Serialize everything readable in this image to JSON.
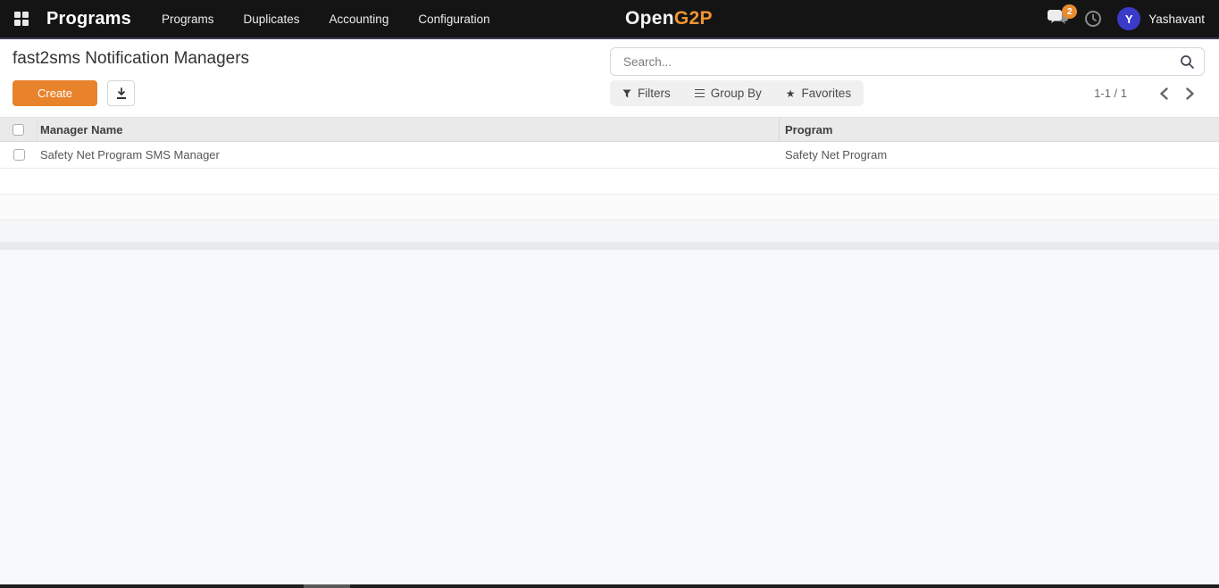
{
  "nav": {
    "brand": "Programs",
    "items": [
      {
        "label": "Programs"
      },
      {
        "label": "Duplicates"
      },
      {
        "label": "Accounting"
      },
      {
        "label": "Configuration"
      }
    ],
    "logo": {
      "part1": "Open",
      "part2": "G2P"
    },
    "messages_badge": "2",
    "user": {
      "initial": "Y",
      "name": "Yashavant"
    }
  },
  "header": {
    "title": "fast2sms Notification Managers",
    "create_label": "Create",
    "search_placeholder": "Search..."
  },
  "controls": {
    "filters_label": "Filters",
    "group_by_label": "Group By",
    "favorites_label": "Favorites",
    "pager": "1-1 / 1"
  },
  "table": {
    "columns": [
      "Manager Name",
      "Program"
    ],
    "rows": [
      {
        "manager_name": "Safety Net Program SMS Manager",
        "program": "Safety Net Program"
      }
    ]
  },
  "icons": {
    "apps_icon": "2x2-grid",
    "messages_icon": "speech-bubbles",
    "activities_icon": "clock",
    "search_icon": "magnifier",
    "download_icon": "arrow-into-tray",
    "filter_icon": "funnel",
    "group_by_icon": "three-bars",
    "favorites_star_icon": "★",
    "chevron_left_icon": "‹",
    "chevron_right_icon": "›"
  },
  "colors": {
    "navbar_bg": "#141414",
    "accent_orange": "#e8832c",
    "logo_orange": "#f0952f",
    "badge_orange": "#e78b2d",
    "avatar_indigo": "#3b3bc9",
    "page_bg": "#f8f9fa"
  }
}
